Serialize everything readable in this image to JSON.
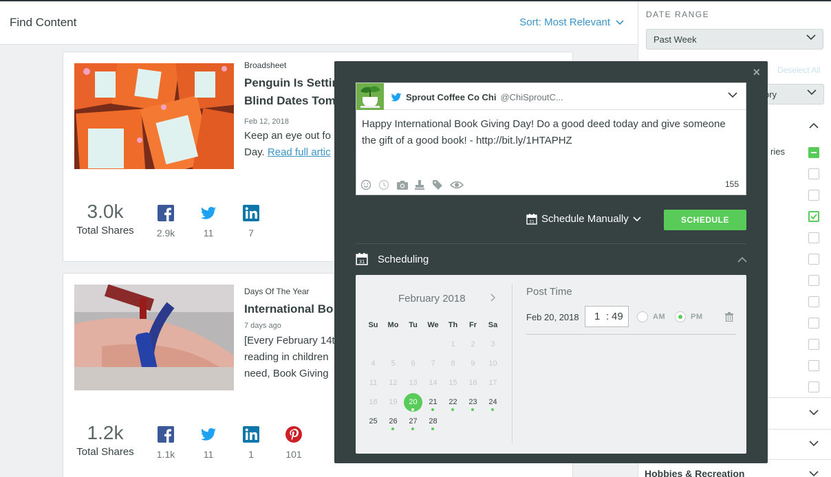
{
  "header": {
    "title": "Find Content",
    "sort_label": "Sort: Most Relevant"
  },
  "cards": [
    {
      "source": "Broadsheet",
      "headline": "Penguin Is Setting Up Blind Dates Tomorrow",
      "headline_line1": "Penguin Is Settin",
      "headline_line2": "Blind Dates Tom",
      "date": "Feb 12, 2018",
      "excerpt_line1": "Keep an eye out fo",
      "excerpt_line2_prefix": "Day. ",
      "link_text": "Read full artic",
      "total": "3.0k",
      "total_label": "Total Shares",
      "shares": {
        "facebook": "2.9k",
        "twitter": "11",
        "linkedin": "7"
      }
    },
    {
      "source": "Days Of The Year",
      "headline_line1": "International Bo",
      "date": "7 days ago",
      "excerpt_line1": "[Every February 14t",
      "excerpt_line2": "reading in children",
      "excerpt_line3": "need, Book Giving",
      "total": "1.2k",
      "total_label": "Total Shares",
      "shares": {
        "facebook": "1.1k",
        "twitter": "11",
        "linkedin": "1",
        "pinterest": "101"
      }
    }
  ],
  "right_panel": {
    "date_range_label": "DATE RANGE",
    "date_range_value": "Past Week",
    "deselect_all": "Deselect All",
    "category_select_text": "ory",
    "stories_label": "ries",
    "hobbies_label": "Hobbies & Recreation"
  },
  "modal": {
    "close": "×",
    "account_name": "Sprout Coffee Co Chi",
    "account_handle": "@ChiSproutC...",
    "message": "Happy International Book Giving Day! Do a good deed today and give someone the gift of a good book! - http://bit.ly/1HTAPHZ",
    "char_count": "155",
    "schedule_mode": "Schedule Manually",
    "schedule_button": "SCHEDULE",
    "scheduling_title": "Scheduling",
    "calendar": {
      "month": "February 2018",
      "weekdays": [
        "Su",
        "Mo",
        "Tu",
        "We",
        "Th",
        "Fr",
        "Sa"
      ],
      "weeks": [
        [
          "",
          "",
          "",
          "",
          "1",
          "2",
          "3"
        ],
        [
          "4",
          "5",
          "6",
          "7",
          "8",
          "9",
          "10"
        ],
        [
          "11",
          "12",
          "13",
          "14",
          "15",
          "16",
          "17"
        ],
        [
          "18",
          "19",
          "20",
          "21",
          "22",
          "23",
          "24"
        ],
        [
          "25",
          "26",
          "27",
          "28",
          "",
          "",
          ""
        ]
      ],
      "selected_day": "20",
      "first_available_day": 20,
      "days_with_posts": [
        "20",
        "21",
        "22",
        "23",
        "24",
        "26",
        "27",
        "28"
      ]
    },
    "post_time_label": "Post Time",
    "post_date": "Feb 20, 2018",
    "hour": "1",
    "minute": "49",
    "am_label": "AM",
    "pm_label": "PM",
    "meridiem": "PM"
  },
  "colors": {
    "accent_green": "#59cb59",
    "link_blue": "#3b95c3",
    "modal_bg": "#364141"
  }
}
